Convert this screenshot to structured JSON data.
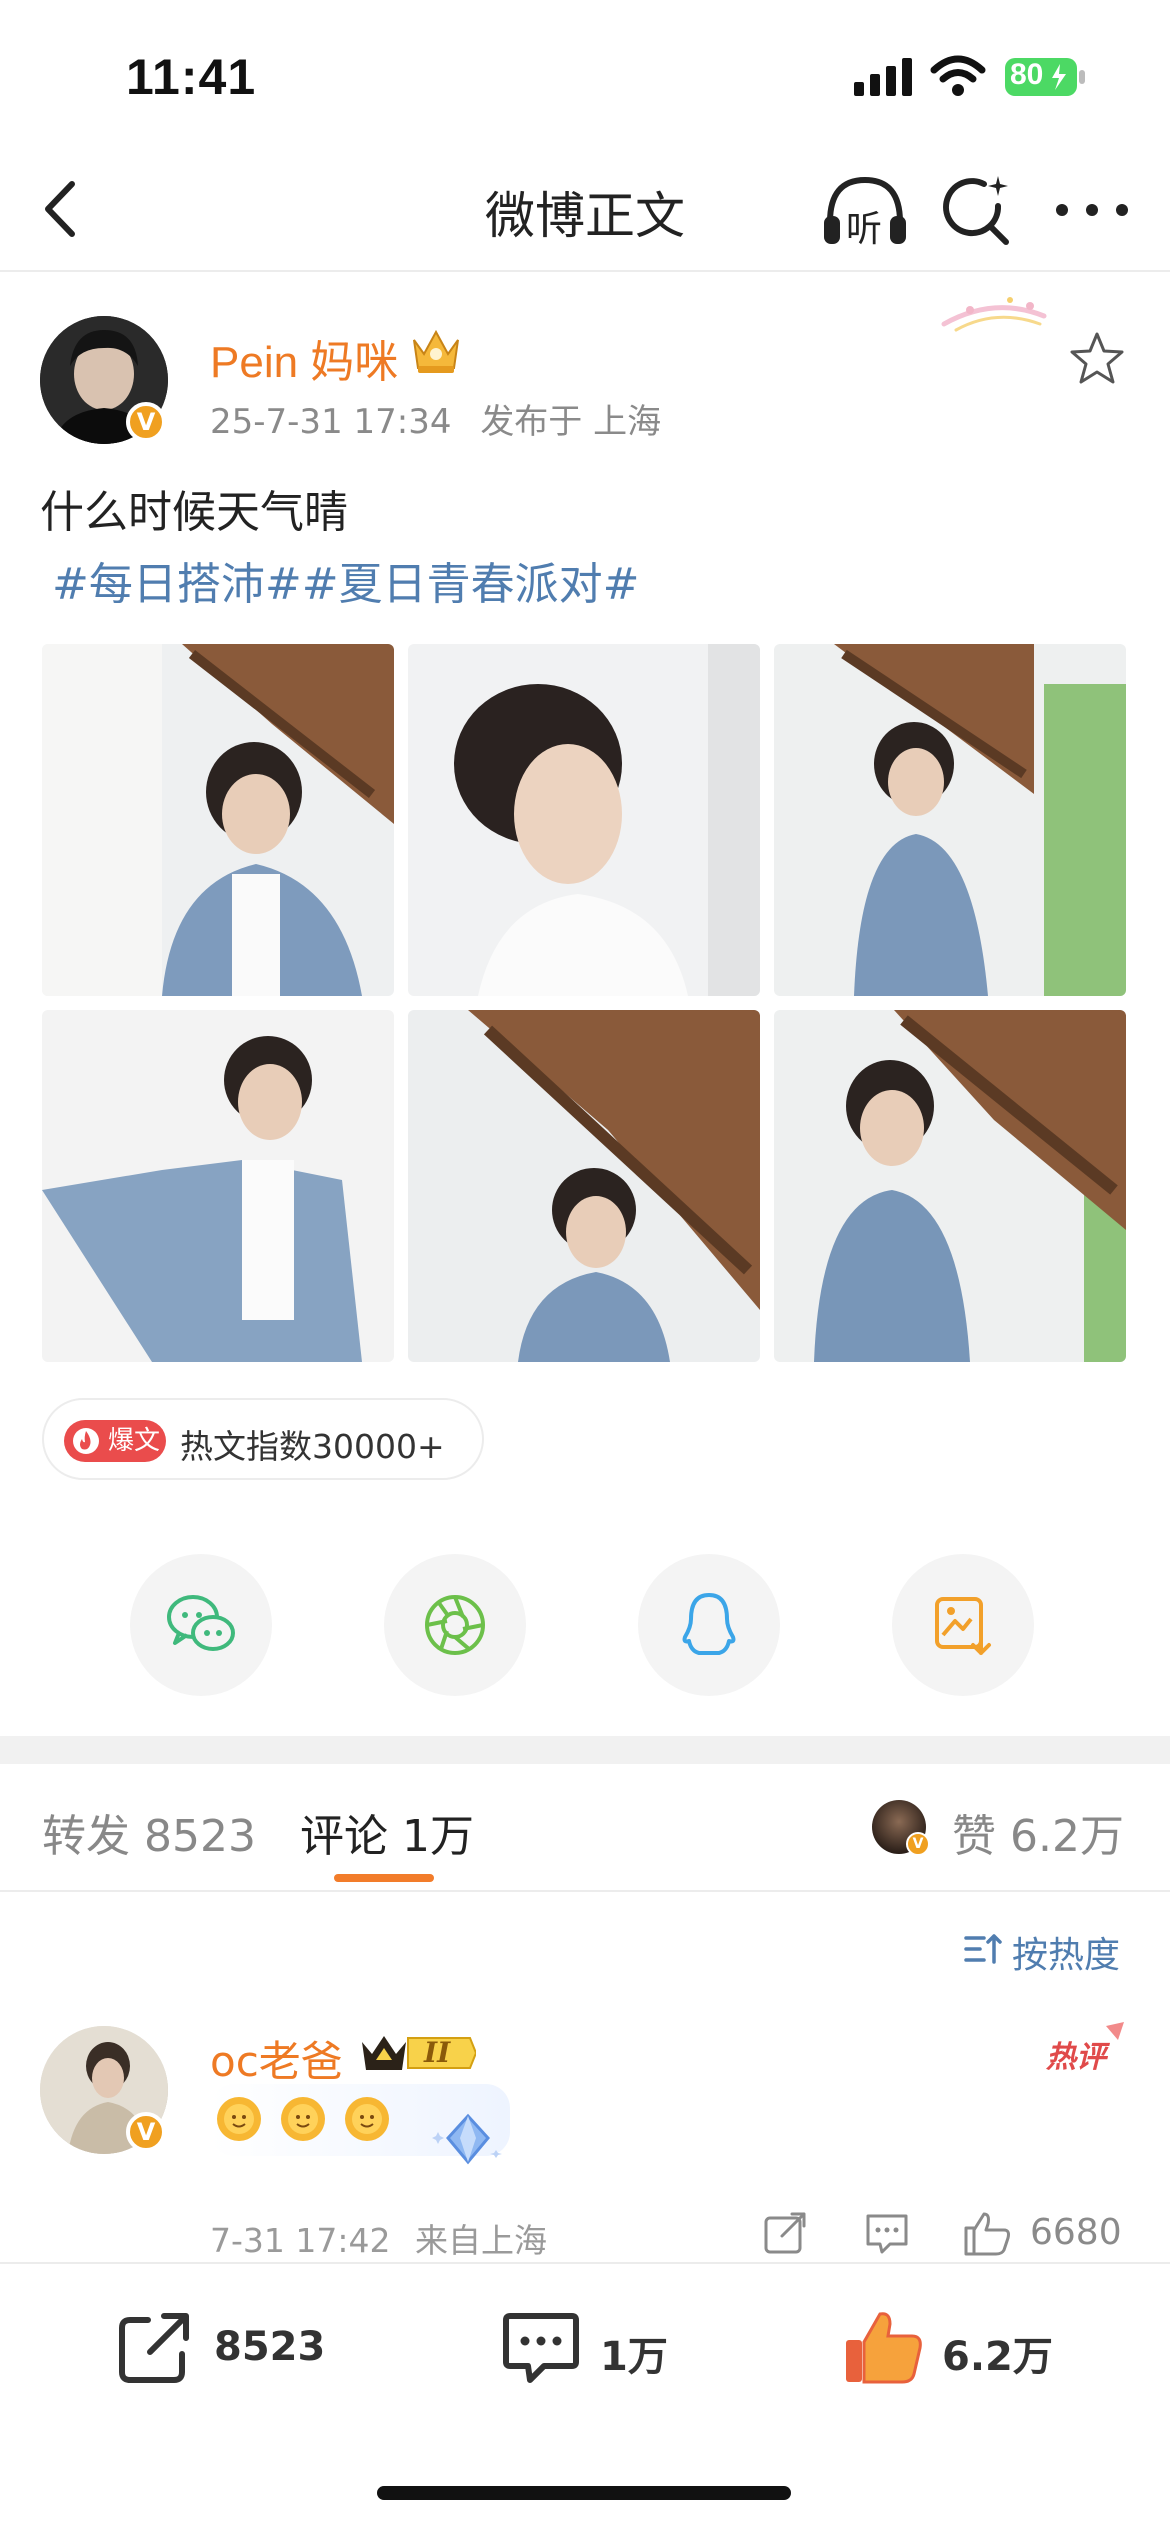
{
  "status_bar": {
    "time": "11:41",
    "battery": "80"
  },
  "nav": {
    "title": "微博正文",
    "listen_label": "听"
  },
  "post": {
    "author": "Pein 妈咪",
    "avatar_badge": "V",
    "date": "25-7-31 17:34",
    "location": "发布于 上海",
    "text": "什么时候天气晴",
    "tags": "#每日搭沛##夏日青春派对#"
  },
  "hot_badge": {
    "tag": "爆文",
    "text": "热文指数30000+"
  },
  "share_targets": [
    "wechat-icon",
    "moments-icon",
    "qq-icon",
    "save-image-icon"
  ],
  "tabs": {
    "repost": "转发 8523",
    "comments": "评论 1万",
    "likes": "赞 6.2万"
  },
  "sort": {
    "label": "按热度"
  },
  "comment": {
    "user": "oc老爸",
    "level": "II",
    "hot_label": "热评",
    "date": "7-31 17:42",
    "location": "来自上海",
    "likes": "6680"
  },
  "toolbar": {
    "repost_count": "8523",
    "comment_count": "1万",
    "like_count": "6.2万"
  },
  "colors": {
    "accent_orange": "#ee7a24",
    "link_blue": "#507daf",
    "hot_red": "#ea4c4c"
  }
}
